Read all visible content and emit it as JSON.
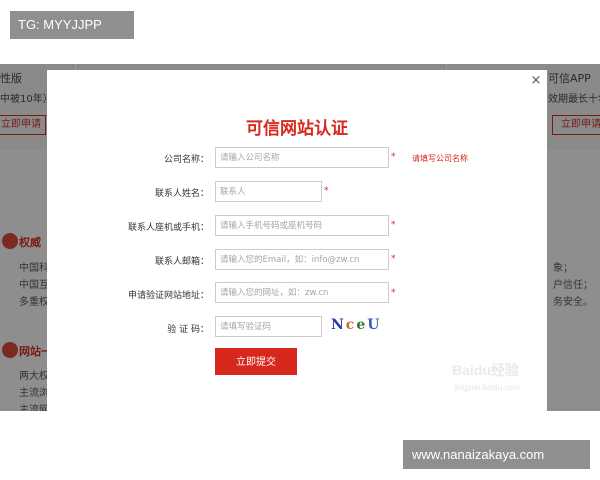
{
  "overlay": {
    "top_left_tag": "TG: MYYJJPP",
    "bottom_right_tag": "www.nanaizakaya.com"
  },
  "background": {
    "left_title_fragment": "性版",
    "left_sub_fragment": "中被10年）",
    "left_button_fragment": "立即申请",
    "right_title_fragment": "可信APP",
    "right_sub_fragment": "效期最长十年",
    "right_button_fragment": "立即申请",
    "section1_title_fragment": "权威",
    "section1_lines": [
      "中国科",
      "中国互",
      "多重权"
    ],
    "section1_right_lines": [
      "象；",
      "户信任；",
      "务安全。"
    ],
    "section2_title_fragment": "网站一",
    "section2_lines": [
      "两大权",
      "主流浏",
      "主流网"
    ]
  },
  "modal": {
    "close_glyph": "×",
    "title": "可信网站认证",
    "fields": [
      {
        "label": "公司名称：",
        "placeholder": "请输入公司名称",
        "required": "*",
        "hint": "请填写公司名称"
      },
      {
        "label": "联系人姓名：",
        "placeholder": "联系人",
        "required": "*"
      },
      {
        "label": "联系人座机或手机：",
        "placeholder": "请输入手机号码或座机号码",
        "required": "*"
      },
      {
        "label": "联系人邮箱：",
        "placeholder": "请输入您的Email，如：info@zw.cn",
        "required": "*"
      },
      {
        "label": "申请验证网站地址：",
        "placeholder": "请输入您的网址，如：zw.cn",
        "required": "*"
      },
      {
        "label": "验 证 码：",
        "placeholder": "请填写验证码",
        "captcha": [
          "N",
          "c",
          "e",
          "U"
        ]
      }
    ],
    "submit_label": "立即提交"
  },
  "watermark": {
    "text": "Baidu经验",
    "sub": "jingyan.baidu.com"
  },
  "colors": {
    "accent_red": "#d8271c",
    "captcha_colors": [
      "#2e3aa8",
      "#c2701a",
      "#2e7a2e",
      "#3a5ec0"
    ]
  }
}
